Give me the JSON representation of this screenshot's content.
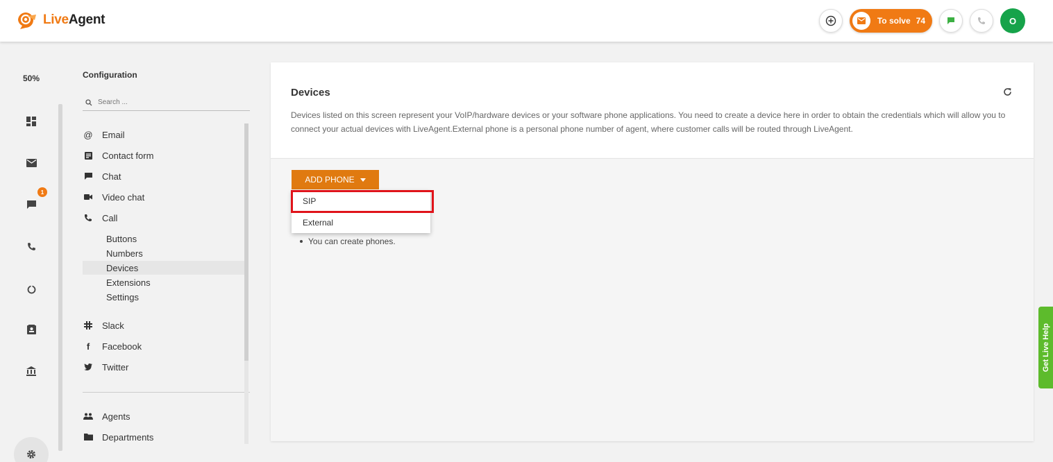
{
  "app": {
    "logo_live": "Live",
    "logo_agent": "Agent",
    "brand_color": "#f07a14"
  },
  "topbar": {
    "to_solve_label": "To solve",
    "to_solve_count": "74",
    "avatar_initial": "O",
    "icons": [
      "add-icon",
      "mail-icon",
      "chat-icon",
      "phone-icon"
    ]
  },
  "rail": {
    "zoom": "50%",
    "mail_badge": "1",
    "items": [
      "dashboard-icon",
      "tickets-icon",
      "chat-icon",
      "phone-icon",
      "reports-icon",
      "contacts-icon",
      "knowledgebase-icon",
      "settings-icon"
    ]
  },
  "config": {
    "title": "Configuration",
    "search_placeholder": "Search ...",
    "items": [
      {
        "label": "Email",
        "icon": "at-icon"
      },
      {
        "label": "Contact form",
        "icon": "form-icon"
      },
      {
        "label": "Chat",
        "icon": "chat-icon"
      },
      {
        "label": "Video chat",
        "icon": "video-icon"
      },
      {
        "label": "Call",
        "icon": "phone-icon"
      }
    ],
    "call_sub": [
      "Buttons",
      "Numbers",
      "Devices",
      "Extensions",
      "Settings"
    ],
    "active_sub": "Devices",
    "social": [
      {
        "label": "Slack",
        "icon": "slack-icon"
      },
      {
        "label": "Facebook",
        "icon": "facebook-icon"
      },
      {
        "label": "Twitter",
        "icon": "twitter-icon"
      }
    ],
    "bottom": [
      {
        "label": "Agents",
        "icon": "agents-icon"
      },
      {
        "label": "Departments",
        "icon": "folder-icon"
      }
    ]
  },
  "main": {
    "title": "Devices",
    "description": "Devices listed on this screen represent your VoIP/hardware devices or your software phone applications. You need to create a device here in order to obtain the credentials which will allow you to connect your actual devices with LiveAgent.External phone is a personal phone number of agent, where customer calls will be routed through LiveAgent.",
    "add_phone_label": "ADD PHONE",
    "dropdown": [
      "SIP",
      "External"
    ],
    "bullet": "You can create phones."
  },
  "live_help": "Get Live Help"
}
